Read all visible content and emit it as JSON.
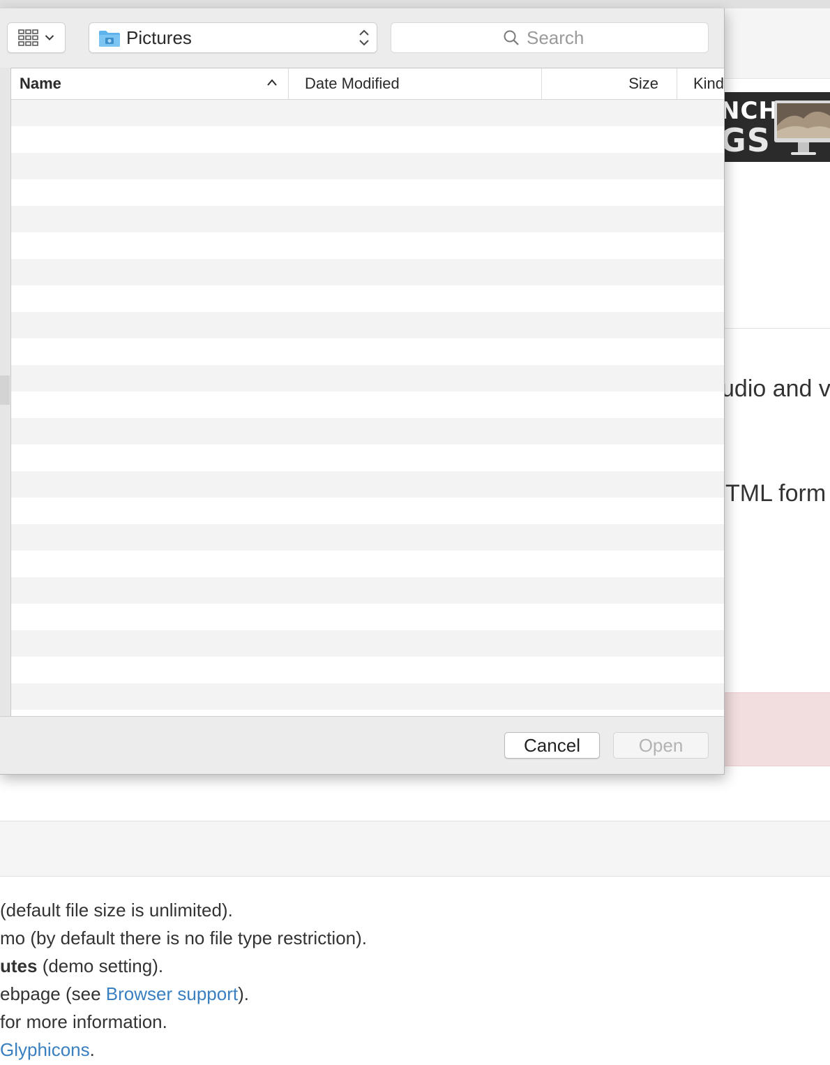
{
  "dialog": {
    "location": {
      "label": "Pictures",
      "icon": "folder-pictures-icon",
      "color": "#5fb3ec"
    },
    "search": {
      "placeholder": "Search"
    },
    "columns": [
      {
        "label": "Name",
        "sorted": "ascending"
      },
      {
        "label": "Date Modified"
      },
      {
        "label": "Size"
      },
      {
        "label": "Kind"
      }
    ],
    "file_rows": [],
    "buttons": {
      "cancel": "Cancel",
      "open": "Open",
      "open_enabled": false
    }
  },
  "background_page": {
    "banner": {
      "line1": "NCH",
      "line2": "GS"
    },
    "snippet_1": "udio and v",
    "snippet_2": "TML form",
    "list": [
      {
        "text": " (default file size is unlimited)."
      },
      {
        "text": "mo (by default there is no file type restriction)."
      },
      {
        "strong": "utes",
        "text": " (demo setting)."
      },
      {
        "pre": "ebpage (see ",
        "link": "Browser support",
        "post": ")."
      },
      {
        "text": "for more information."
      },
      {
        "pre": " ",
        "link": "Glyphicons",
        "post": "."
      }
    ],
    "colors": {
      "link": "#3a7fc0",
      "alert_bg": "#f2dede"
    }
  }
}
